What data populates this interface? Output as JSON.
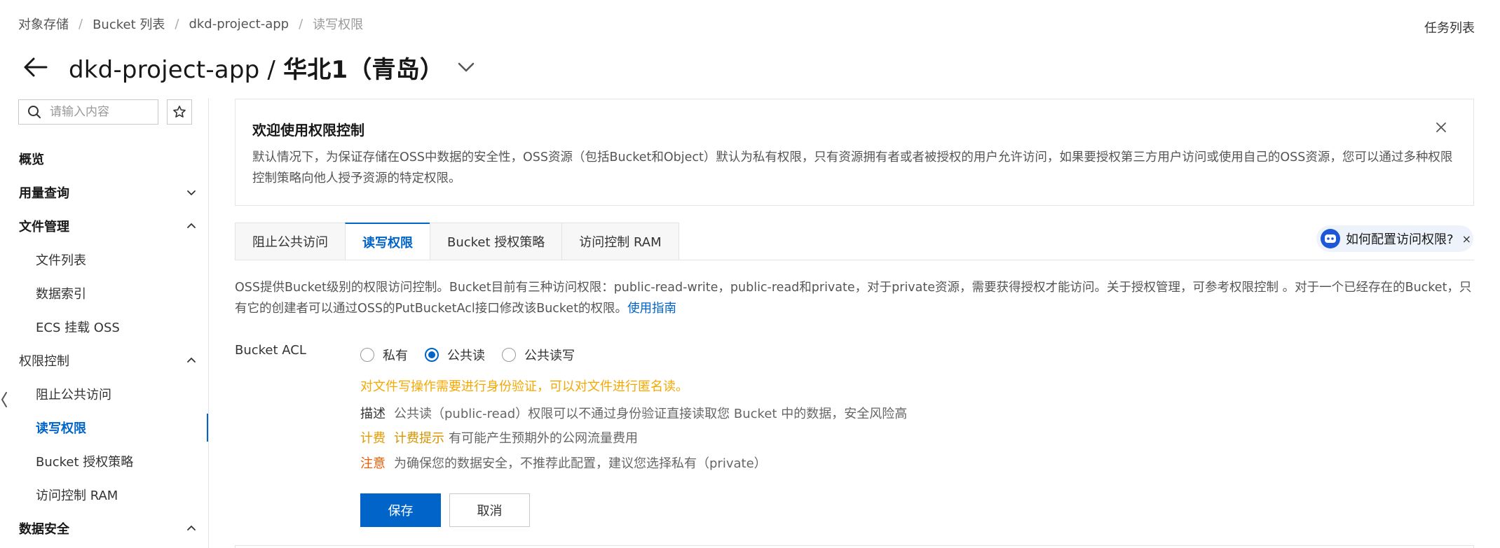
{
  "breadcrumb": [
    "对象存储",
    "Bucket 列表",
    "dkd-project-app",
    "读写权限"
  ],
  "breadcrumb_separator": "/",
  "task_list_label": "任务列表",
  "header": {
    "title_prefix": "dkd-project-app / ",
    "title_region": "华北1（青岛）"
  },
  "sidebar": {
    "search_placeholder": "请输入内容",
    "items": [
      {
        "label": "概览",
        "type": "group"
      },
      {
        "label": "用量查询",
        "type": "group",
        "chevron": "down"
      },
      {
        "label": "文件管理",
        "type": "group",
        "chevron": "up"
      },
      {
        "label": "文件列表",
        "type": "sub"
      },
      {
        "label": "数据索引",
        "type": "sub"
      },
      {
        "label": "ECS 挂载 OSS",
        "type": "sub"
      },
      {
        "label": "权限控制",
        "type": "sub-group",
        "chevron": "up"
      },
      {
        "label": "阻止公共访问",
        "type": "sub"
      },
      {
        "label": "读写权限",
        "type": "sub",
        "active": true
      },
      {
        "label": "Bucket 授权策略",
        "type": "sub"
      },
      {
        "label": "访问控制 RAM",
        "type": "sub"
      },
      {
        "label": "数据安全",
        "type": "group",
        "chevron": "up"
      }
    ]
  },
  "banner": {
    "title": "欢迎使用权限控制",
    "text": "默认情况下，为保证存储在OSS中数据的安全性，OSS资源（包括Bucket和Object）默认为私有权限，只有资源拥有者或者被授权的用户允许访问，如果要授权第三方用户访问或使用自己的OSS资源，您可以通过多种权限控制策略向他人授予资源的特定权限。"
  },
  "tabs": [
    {
      "label": "阻止公共访问"
    },
    {
      "label": "读写权限",
      "active": true
    },
    {
      "label": "Bucket 授权策略"
    },
    {
      "label": "访问控制 RAM"
    }
  ],
  "assistant": {
    "label": "如何配置访问权限?",
    "close": "×"
  },
  "description": {
    "text": "OSS提供Bucket级别的权限访问控制。Bucket目前有三种访问权限：public-read-write，public-read和private，对于private资源，需要获得授权才能访问。关于授权管理，可参考权限控制 。对于一个已经存在的Bucket，只有它的创建者可以通过OSS的PutBucketAcl接口修改该Bucket的权限。",
    "link": "使用指南"
  },
  "acl": {
    "label": "Bucket ACL",
    "options": [
      "私有",
      "公共读",
      "公共读写"
    ],
    "selected": "公共读",
    "warning": "对文件写操作需要进行身份验证，可以对文件进行匿名读。",
    "desc_key": "描述",
    "desc_value": "公共读（public-read）权限可以不通过身份验证直接读取您 Bucket 中的数据，安全风险高",
    "fee_key": "计费",
    "fee_hint": "计费提示",
    "fee_value": "有可能产生预期外的公网流量费用",
    "note_key": "注意",
    "note_value": "为确保您的数据安全，不推荐此配置，建议您选择私有（private）"
  },
  "buttons": {
    "save": "保存",
    "cancel": "取消"
  },
  "colors": {
    "primary": "#0064c8",
    "warning": "#f5a800",
    "note": "#f05a00"
  }
}
